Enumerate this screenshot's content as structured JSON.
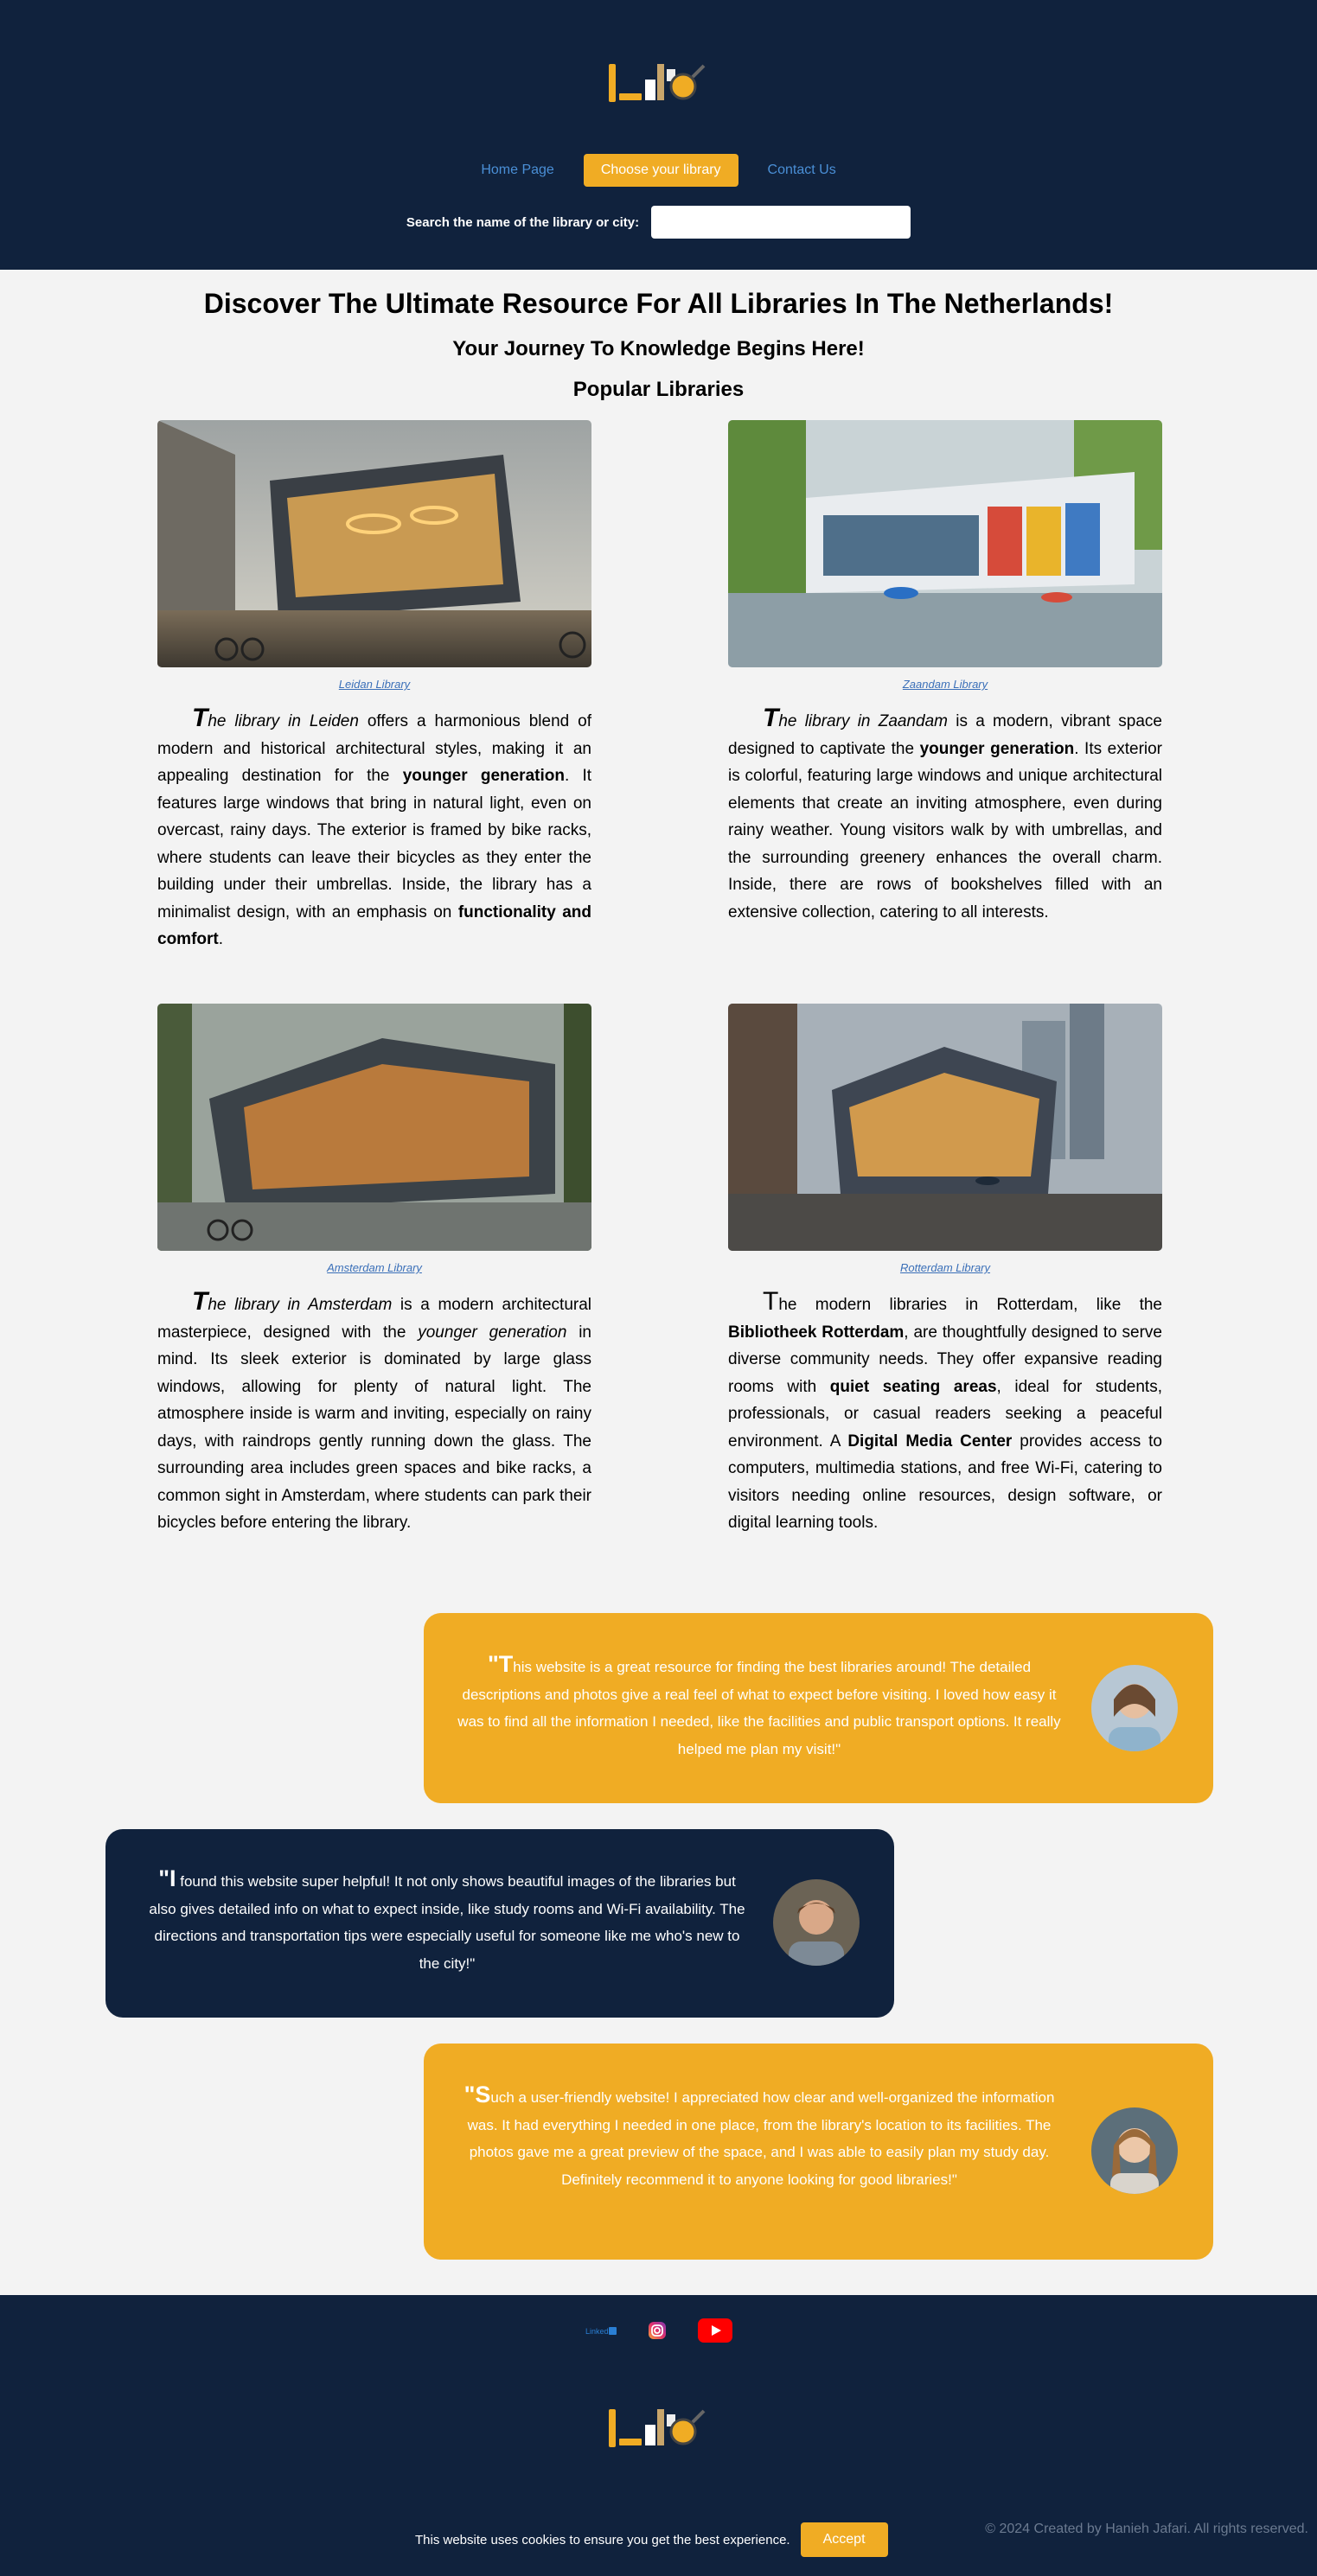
{
  "nav": {
    "home": "Home Page",
    "choose": "Choose your library",
    "contact": "Contact Us"
  },
  "search": {
    "label": "Search the name of the library or city:",
    "value": ""
  },
  "headings": {
    "main": "Discover The Ultimate Resource For All Libraries In The Netherlands!",
    "sub": "Your Journey To Knowledge Begins Here!",
    "popular": "Popular Libraries"
  },
  "libraries": [
    {
      "caption": "Leidan Library",
      "lead": "T",
      "intro": "he library in Leiden",
      "p1": " offers a harmonious blend of modern and historical architectural styles, making it an appealing destination for the ",
      "b1": "younger generation",
      "p2": ". It features large windows that bring in natural light, even on overcast, rainy days. The exterior is framed by bike racks, where students can leave their bicycles as they enter the building under their umbrellas. Inside, the library has a minimalist design, with an emphasis on ",
      "b2": "functionality and comfort",
      "p3": "."
    },
    {
      "caption": "Zaandam Library",
      "lead": "T",
      "intro": "he library in Zaandam",
      "p1": " is a modern, vibrant space designed to captivate the ",
      "b1": "younger generation",
      "p2": ". Its exterior is colorful, featuring large windows and unique architectural elements that create an inviting atmosphere, even during rainy weather. Young visitors walk by with umbrellas, and the surrounding greenery enhances the overall charm. Inside, there are rows of bookshelves filled with an extensive collection, catering to all interests."
    },
    {
      "caption": "Amsterdam Library",
      "lead": "T",
      "intro": "he library in Amsterdam",
      "p1": " is a modern architectural masterpiece, designed with the ",
      "i1": "younger generation",
      "p2": " in mind. Its sleek exterior is dominated by large glass windows, allowing for plenty of natural light. The atmosphere inside is warm and inviting, especially on rainy days, with raindrops gently running down the glass. The surrounding area includes green spaces and bike racks, a common sight in Amsterdam, where students can park their bicycles before entering the library."
    },
    {
      "caption": "Rotterdam Library",
      "lead": "T",
      "p1": "he modern libraries in Rotterdam, like the ",
      "b1": "Bibliotheek Rotterdam",
      "p2": ", are thoughtfully designed to serve diverse community needs. They offer expansive reading rooms with ",
      "b2": "quiet seating areas",
      "p3": ", ideal for students, professionals, or casual readers seeking a peaceful environment. A ",
      "b3": "Digital Media Center",
      "p4": " provides access to computers, multimedia stations, and free Wi-Fi, catering to visitors needing online resources, design software, or digital learning tools."
    }
  ],
  "testimonials": [
    {
      "lead": "\"T",
      "text": "his website is a great resource for finding the best libraries around! The detailed descriptions and photos give a real feel of what to expect before visiting. I loved how easy it was to find all the information I needed, like the facilities and public transport options. It really helped me plan my visit!\""
    },
    {
      "lead": "\"I",
      "text": " found this website super helpful! It not only shows beautiful images of the libraries but also gives detailed info on what to expect inside, like study rooms and Wi-Fi availability. The directions and transportation tips were especially useful for someone like me who's new to the city!\""
    },
    {
      "lead": "\"S",
      "text": "uch a user-friendly website! I appreciated how clear and well-organized the information was. It had everything I needed in one place, from the library's location to its facilities. The photos gave me a great preview of the space, and I was able to easily plan my study day. Definitely recommend it to anyone looking for good libraries!\""
    }
  ],
  "footer": {
    "social_icons": [
      "linkedin-icon",
      "instagram-icon",
      "youtube-icon"
    ],
    "copyright": "© 2024 Created by Hanieh Jafari. All rights reserved.",
    "cookie_text": "This website uses cookies to ensure you get the best experience.",
    "cookie_button": "Accept"
  },
  "colors": {
    "navy": "#10223d",
    "gold": "#f0ac24",
    "link": "#4a8fd6",
    "background": "#f3f3f3"
  }
}
